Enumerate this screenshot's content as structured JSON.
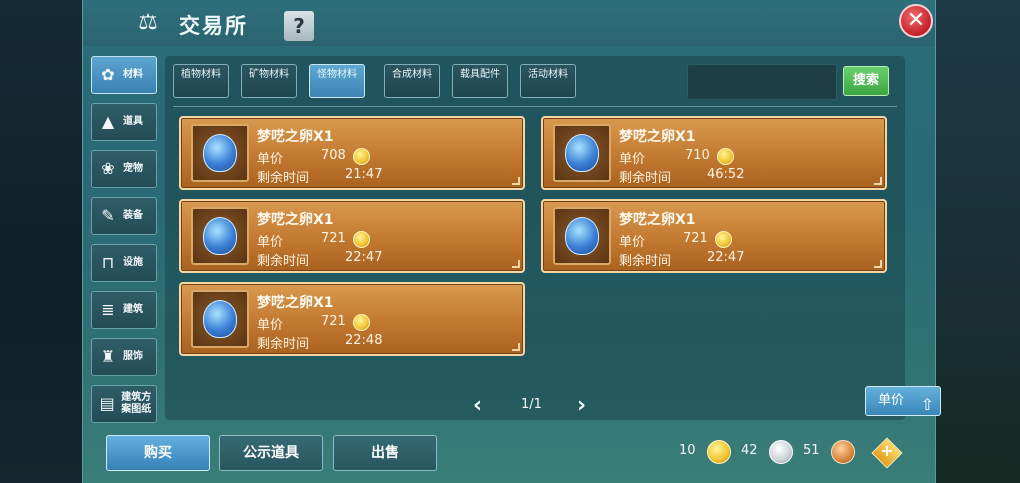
{
  "window": {
    "title": "交易所",
    "help_label": "?",
    "close_label": "✕"
  },
  "sidebar": {
    "items": [
      {
        "label": "材料",
        "icon": "materials-icon",
        "glyph": "✿",
        "active": true
      },
      {
        "label": "道具",
        "icon": "item-icon",
        "glyph": "▲",
        "active": false
      },
      {
        "label": "宠物",
        "icon": "paw-icon",
        "glyph": "❀",
        "active": false
      },
      {
        "label": "装备",
        "icon": "equipment-icon",
        "glyph": "✎",
        "active": false
      },
      {
        "label": "设施",
        "icon": "facility-icon",
        "glyph": "⊓",
        "active": false
      },
      {
        "label": "建筑",
        "icon": "building-icon",
        "glyph": "≣",
        "active": false
      },
      {
        "label": "服饰",
        "icon": "clothing-icon",
        "glyph": "♜",
        "active": false
      },
      {
        "label": "建筑方案图纸",
        "icon": "blueprint-icon",
        "glyph": "▤",
        "active": false
      }
    ]
  },
  "tabs": [
    {
      "label": "植物材料",
      "active": false
    },
    {
      "label": "矿物材料",
      "active": false
    },
    {
      "label": "怪物材料",
      "active": true
    },
    {
      "label": "合成材料",
      "active": false
    },
    {
      "label": "载具配件",
      "active": false
    },
    {
      "label": "活动材料",
      "active": false
    }
  ],
  "search": {
    "value": "",
    "button_label": "搜索"
  },
  "listings": [
    {
      "name": "梦呓之卵X1",
      "price_label": "单价",
      "price": "708",
      "time_label": "剩余时间",
      "time": "21:47"
    },
    {
      "name": "梦呓之卵X1",
      "price_label": "单价",
      "price": "710",
      "time_label": "剩余时间",
      "time": "46:52"
    },
    {
      "name": "梦呓之卵X1",
      "price_label": "单价",
      "price": "721",
      "time_label": "剩余时间",
      "time": "22:47"
    },
    {
      "name": "梦呓之卵X1",
      "price_label": "单价",
      "price": "721",
      "time_label": "剩余时间",
      "time": "22:47"
    },
    {
      "name": "梦呓之卵X1",
      "price_label": "单价",
      "price": "721",
      "time_label": "剩余时间",
      "time": "22:48"
    }
  ],
  "pager": {
    "prev": "‹",
    "next": "›",
    "text": "1/1"
  },
  "sort": {
    "label": "单价",
    "icon_glyph": "⇧"
  },
  "bottom": {
    "buy": "购买",
    "public": "公示道具",
    "sell": "出售"
  },
  "currency": {
    "gold": "10",
    "silver": "42",
    "copper": "51",
    "add": "+"
  },
  "colors": {
    "accent_blue": "#3a82b2",
    "card_orange": "#c77f36",
    "search_green": "#3da542",
    "close_red": "#c4202a"
  }
}
